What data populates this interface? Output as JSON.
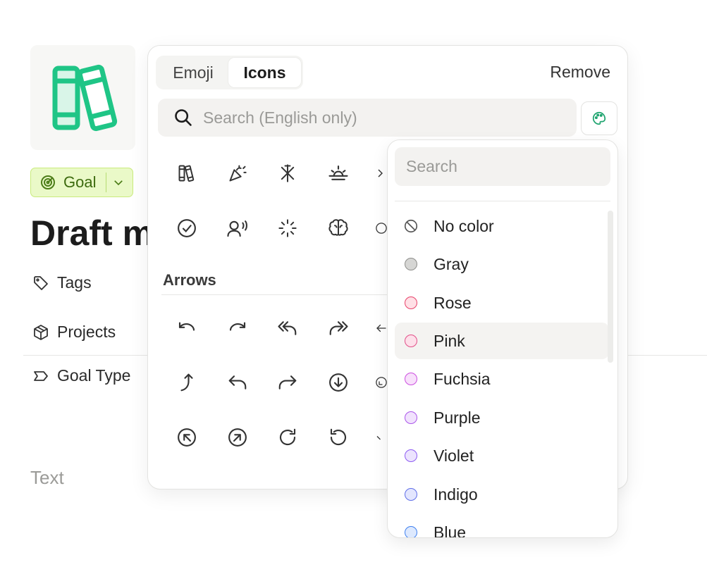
{
  "page": {
    "badge_label": "Goal",
    "title": "Draft m",
    "properties": [
      "Tags",
      "Projects",
      "Goal Type"
    ],
    "text_placeholder": "Text"
  },
  "picker": {
    "tabs": [
      "Emoji",
      "Icons"
    ],
    "active_tab": "Icons",
    "remove_label": "Remove",
    "search_placeholder": "Search (English only)",
    "section_label": "Arrows",
    "icons_row1": [
      "books-icon",
      "party-popper-icon",
      "sparkle-icon",
      "sunrise-icon"
    ],
    "icons_row2": [
      "check-circle-icon",
      "user-voice-icon",
      "loader-icon",
      "brain-icon"
    ],
    "arrows_row1": [
      "undo-icon",
      "redo-icon",
      "reply-all-icon",
      "forward-all-icon"
    ],
    "arrows_row2": [
      "corner-up-icon",
      "reply-icon",
      "forward-icon",
      "arrow-down-circle-icon"
    ],
    "arrows_row3": [
      "arrow-up-left-circle-icon",
      "arrow-up-right-circle-icon",
      "rotate-cw-icon",
      "rotate-ccw-icon"
    ]
  },
  "color_dropdown": {
    "search_placeholder": "Search",
    "highlighted": "Pink",
    "items": [
      {
        "label": "No color",
        "color": null
      },
      {
        "label": "Gray",
        "color": "#d6d6d4",
        "border": "#8e8e8b"
      },
      {
        "label": "Rose",
        "color": "#ffe0e6",
        "border": "#e8426a"
      },
      {
        "label": "Pink",
        "color": "#fde0ea",
        "border": "#e24f88"
      },
      {
        "label": "Fuchsia",
        "color": "#f8e0fb",
        "border": "#cc4fe0"
      },
      {
        "label": "Purple",
        "color": "#f1e2fd",
        "border": "#ab55ea"
      },
      {
        "label": "Violet",
        "color": "#ece3fe",
        "border": "#8d5bf2"
      },
      {
        "label": "Indigo",
        "color": "#e3e6fe",
        "border": "#5f6ee8"
      },
      {
        "label": "Blue",
        "color": "#dde9fe",
        "border": "#3f80ef"
      }
    ]
  },
  "colors": {
    "accent_green": "#1fc586",
    "badge_bg": "#eaf9c8",
    "badge_text": "#3d6b0f"
  }
}
